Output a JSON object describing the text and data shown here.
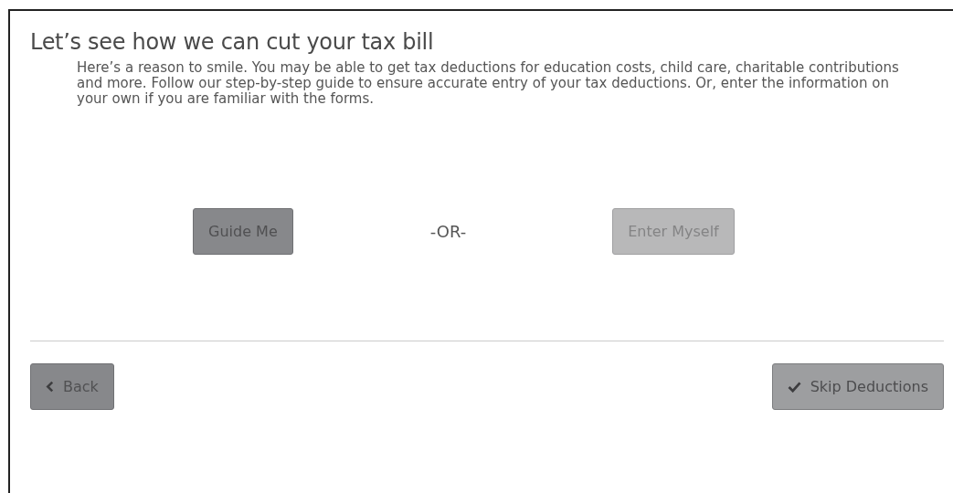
{
  "title": "Let’s see how we can cut your tax bill",
  "intro": "Here’s a reason to smile. You may be able to get tax deductions for education costs, child care, charitable contributions and more. Follow our step-by-step guide to ensure accurate entry of your tax deductions. Or, enter the information on your own if you are familiar with the forms.",
  "choices": [
    {
      "label": "Guide Me",
      "kind": "dark"
    },
    {
      "label": "Enter Myself",
      "kind": "light"
    }
  ],
  "separator": "-OR-",
  "footer": {
    "back": {
      "label": "Back",
      "kind": "dark"
    },
    "skip": {
      "label": "Skip Deductions",
      "kind": "medium"
    }
  }
}
